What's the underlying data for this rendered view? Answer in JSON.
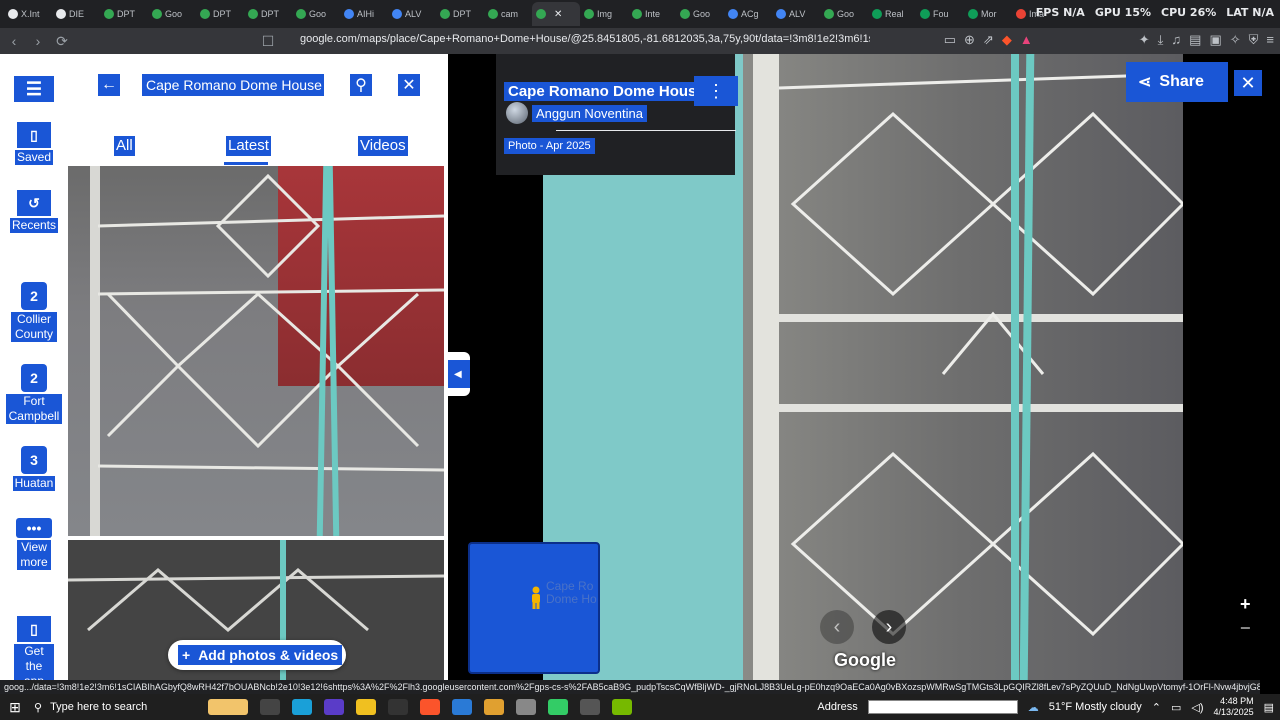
{
  "browser": {
    "tabs": [
      {
        "label": "X.Int",
        "color": "#e8eaed"
      },
      {
        "label": "DIE",
        "color": "#e8eaed"
      },
      {
        "label": "DPT",
        "color": "#34a853"
      },
      {
        "label": "Goo",
        "color": "#34a853"
      },
      {
        "label": "DPT",
        "color": "#34a853"
      },
      {
        "label": "DPT",
        "color": "#34a853"
      },
      {
        "label": "Goo",
        "color": "#34a853"
      },
      {
        "label": "AIHi",
        "color": "#4285f4"
      },
      {
        "label": "ALV",
        "color": "#4285f4"
      },
      {
        "label": "DPT",
        "color": "#34a853"
      },
      {
        "label": "cam",
        "color": "#34a853"
      },
      {
        "label": "",
        "color": "#34a853",
        "active": true
      },
      {
        "label": "Img",
        "color": "#34a853"
      },
      {
        "label": "Inte",
        "color": "#34a853"
      },
      {
        "label": "Goo",
        "color": "#34a853"
      },
      {
        "label": "ACg",
        "color": "#4285f4"
      },
      {
        "label": "ALV",
        "color": "#4285f4"
      },
      {
        "label": "Goo",
        "color": "#34a853"
      },
      {
        "label": "Real",
        "color": "#0f9d58"
      },
      {
        "label": "Fou",
        "color": "#0f9d58"
      },
      {
        "label": "Mor",
        "color": "#0f9d58"
      },
      {
        "label": "Ima",
        "color": "#ea4335"
      }
    ],
    "perf": {
      "fps": "FPS N/A",
      "gpu": "GPU 15%",
      "cpu": "CPU 26%",
      "lat": "LAT N/A"
    },
    "url": "google.com/maps/place/Cape+Romano+Dome+House/@25.8451805,-81.6812035,3a,75y,90t/data=!3m8!1e2!3m6!1sCIABIhAGbyfQ8wR..."
  },
  "rail": {
    "saved": "Saved",
    "recents": "Recents",
    "recent_items": [
      {
        "badge": "2",
        "label": "Collier County"
      },
      {
        "badge": "2",
        "label": "Fort Campbell"
      },
      {
        "badge": "3",
        "label": "Huatan"
      }
    ],
    "view_more": "View more",
    "get_app": "Get the app"
  },
  "panel": {
    "search_value": "Cape Romano Dome House",
    "tabs": [
      "All",
      "Latest",
      "Videos"
    ],
    "add_photos": "Add photos & videos"
  },
  "viewer": {
    "title": "Cape Romano Dome House",
    "author": "Anggun Noventina",
    "date": "Photo - Apr 2025",
    "share": "Share",
    "minimap_label": "Cape Ro Dome Ho",
    "logo": "Google"
  },
  "status_url": "goog.../data=!3m8!1e2!3m6!1sCIABIhAGbyfQ8wRH42f7bOUABNcb!2e10!3e12!6shttps%3A%2F%2Flh3.googleusercontent.com%2Fgps-cs-s%2FAB5caB9G_pudpTscsCqWfBljWD-_gjRNoLJ8B3UeLg-pE0hzq9OaECa0Ag0vBXozspWMRwSgTMGts3LpGQIRZl8fLev7sPyZQUuD_NdNgUwpVtomyf-1OrFl-Nvw4jbvjG8vVYtEGe08ZaFced6%3Dw203-h203-k-no!7i...",
  "taskbar": {
    "search_placeholder": "Type here to search",
    "address_label": "Address",
    "weather": "51°F  Mostly cloudy",
    "time": "4:48 PM",
    "date": "4/13/2025"
  }
}
